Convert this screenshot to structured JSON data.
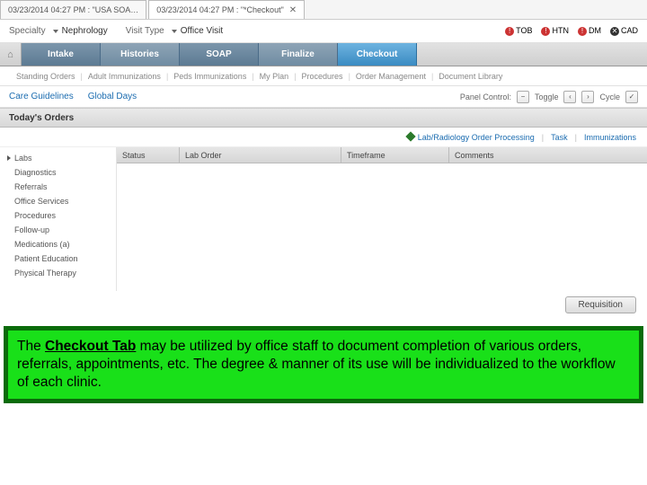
{
  "tabs": {
    "left": "03/23/2014 04:27 PM : \"USA SOA…",
    "right": "03/23/2014 04:27 PM : \"*Checkout\""
  },
  "fields": {
    "specialty_label": "Specialty",
    "specialty_value": "Nephrology",
    "visit_label": "Visit Type",
    "visit_value": "Office Visit"
  },
  "alerts": [
    {
      "code": "TOB",
      "style": "red"
    },
    {
      "code": "HTN",
      "style": "red"
    },
    {
      "code": "DM",
      "style": "red"
    },
    {
      "code": "CAD",
      "style": "dark"
    }
  ],
  "main_tabs": [
    "Intake",
    "Histories",
    "SOAP",
    "Finalize",
    "Checkout"
  ],
  "active_main_tab": "Checkout",
  "subnav": [
    "Standing Orders",
    "Adult Immunizations",
    "Peds Immunizations",
    "My Plan",
    "Procedures",
    "Order Management",
    "Document Library"
  ],
  "subnav2": [
    "Care Guidelines",
    "Global Days"
  ],
  "panel_control": {
    "label": "Panel Control:",
    "toggle": "Toggle",
    "cycle": "Cycle"
  },
  "section_header": "Today's Orders",
  "action_links": {
    "lab": "Lab/Radiology Order Processing",
    "task": "Task",
    "imm": "Immunizations"
  },
  "order_categories": [
    "Labs",
    "Diagnostics",
    "Referrals",
    "Office Services",
    "Procedures",
    "Follow-up",
    "Medications (a)",
    "Patient Education",
    "Physical Therapy"
  ],
  "columns": {
    "status": "Status",
    "lab": "Lab Order",
    "time": "Timeframe",
    "comments": "Comments"
  },
  "buttons": {
    "requisition": "Requisition"
  },
  "instruction": {
    "pre": "The ",
    "boldu": "Checkout Tab",
    "rest": " may be utilized by office staff to document completion of various orders, referrals, appointments, etc.  The degree & manner of its use will be individualized to the workflow of each clinic."
  }
}
